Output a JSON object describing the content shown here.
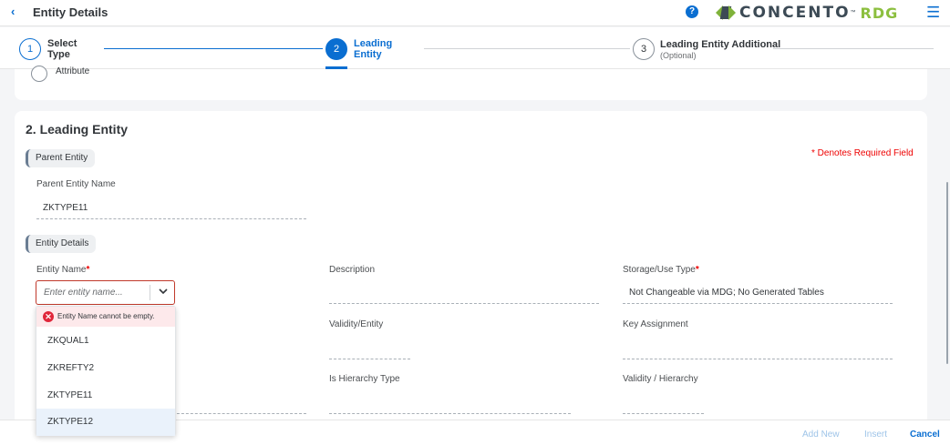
{
  "header": {
    "back_icon": "chevron-left-icon",
    "title": "Entity Details",
    "help_icon": "question-circle-icon",
    "help_glyph": "?",
    "logo_text": "CONCENTO",
    "logo_tm": "™",
    "logo_suffix": "RDG",
    "menu_icon": "hamburger-menu-icon",
    "accent_color": "#0a6ed1"
  },
  "steps": [
    {
      "number": "1",
      "label": "Select Type",
      "status": "completed"
    },
    {
      "number": "2",
      "label": "Leading Entity",
      "status": "active"
    },
    {
      "number": "3",
      "label": "Leading Entity Additional",
      "sublabel": "(Optional)",
      "status": "pending"
    }
  ],
  "previous_section": {
    "radio_label": "Attribute"
  },
  "section": {
    "title": "2. Leading Entity",
    "required_note": "* Denotes Required Field"
  },
  "parent_entity": {
    "group_label": "Parent Entity",
    "name_label": "Parent Entity Name",
    "name_value": "ZKTYPE11"
  },
  "entity_details": {
    "group_label": "Entity Details",
    "entity_name": {
      "label": "Entity Name",
      "required_mark": "*",
      "value": "",
      "placeholder": "Enter entity name...",
      "error": "Entity Name cannot be empty.",
      "options": [
        "ZKQUAL1",
        "ZKREFTY2",
        "ZKTYPE11",
        "ZKTYPE12"
      ],
      "highlighted_option": "ZKTYPE12"
    },
    "description": {
      "label": "Description",
      "value": ""
    },
    "storage_use_type": {
      "label": "Storage/Use Type",
      "required_mark": "*",
      "value": "Not Changeable via MDG; No Generated Tables"
    },
    "validity_entity": {
      "label": "Validity/Entity",
      "value": ""
    },
    "key_assignment": {
      "label": "Key Assignment",
      "value": ""
    },
    "is_hierarchy_type": {
      "label": "Is Hierarchy Type",
      "value": ""
    },
    "validity_hierarchy": {
      "label": "Validity / Hierarchy",
      "value": ""
    }
  },
  "footer": {
    "add_new": "Add New",
    "insert": "Insert",
    "cancel": "Cancel"
  }
}
